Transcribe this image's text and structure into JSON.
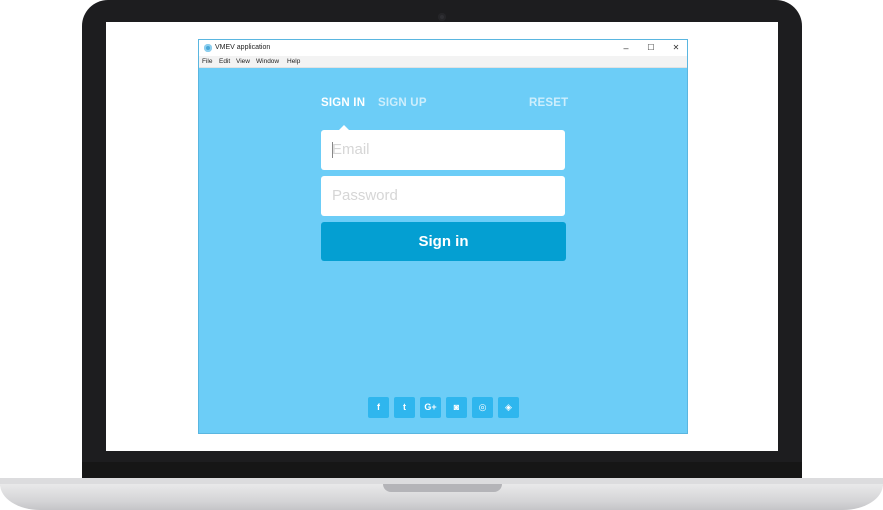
{
  "window": {
    "title": "VMEV application",
    "controls": {
      "minimize": "–",
      "maximize": "☐",
      "close": "✕"
    }
  },
  "menu": [
    "File",
    "Edit",
    "View",
    "Window",
    "Help"
  ],
  "tabs": {
    "sign_in": "SIGN IN",
    "sign_up": "SIGN UP",
    "reset": "RESET",
    "active": "sign_in"
  },
  "form": {
    "email_placeholder": "Email",
    "email_value": "",
    "password_placeholder": "Password",
    "password_value": "",
    "submit_label": "Sign in"
  },
  "social": [
    {
      "name": "facebook-icon",
      "glyph": "f"
    },
    {
      "name": "twitter-icon",
      "glyph": "t"
    },
    {
      "name": "google-plus-icon",
      "glyph": "G+"
    },
    {
      "name": "github-icon",
      "glyph": "◙"
    },
    {
      "name": "dribbble-icon",
      "glyph": "◎"
    },
    {
      "name": "codepen-icon",
      "glyph": "◈"
    }
  ],
  "colors": {
    "window_bg": "#6ccdf7",
    "button_bg": "#049fd2",
    "social_bg": "#2fb6ee",
    "laptop_bezel": "#1d1d1f"
  }
}
